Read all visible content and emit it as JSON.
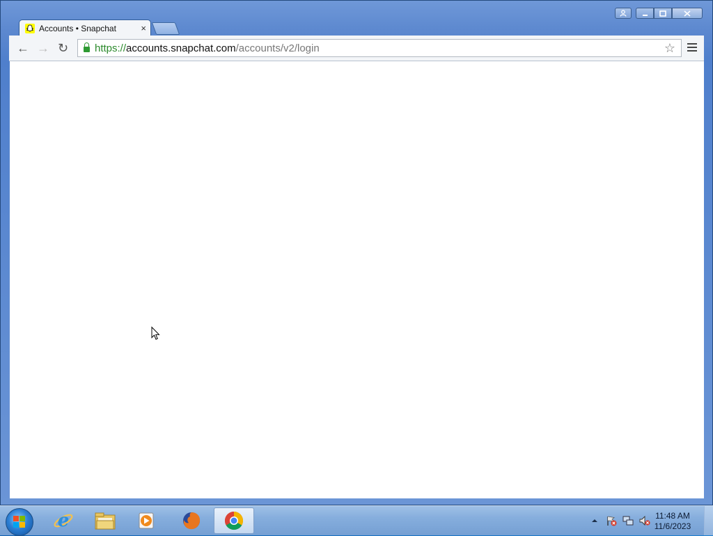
{
  "browser": {
    "tab": {
      "title": "Accounts • Snapchat",
      "close_glyph": "×"
    },
    "toolbar": {
      "back_glyph": "←",
      "forward_glyph": "→",
      "reload_glyph": "↻",
      "star_glyph": "☆"
    },
    "omnibox": {
      "url_scheme": "https://",
      "url_host": "accounts.snapchat.com",
      "url_path": "/accounts/v2/login"
    }
  },
  "taskbar": {
    "apps": [
      {
        "name": "internet-explorer",
        "icon": "ie-icon"
      },
      {
        "name": "file-explorer",
        "icon": "folder-icon"
      },
      {
        "name": "media-player",
        "icon": "media-player-icon"
      },
      {
        "name": "firefox",
        "icon": "firefox-icon"
      },
      {
        "name": "chrome",
        "icon": "chrome-icon",
        "active": true
      }
    ],
    "clock": {
      "time": "11:48 AM",
      "date": "11/6/2023"
    }
  },
  "colors": {
    "snapchat_yellow": "#fffc00",
    "secure_green": "#2c8a2c"
  }
}
